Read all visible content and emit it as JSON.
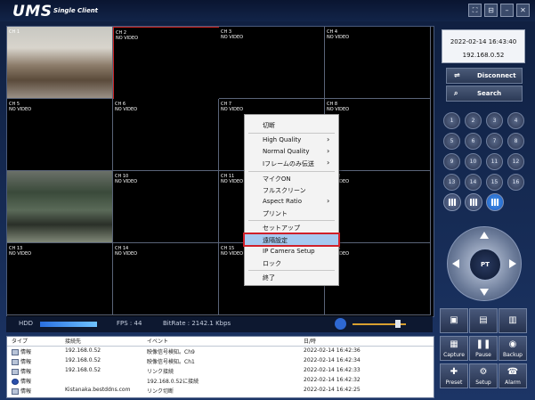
{
  "window": {
    "logo": "UMS",
    "subtitle": "Single Client",
    "controls": [
      "⛶",
      "⊟",
      "–",
      "✕"
    ]
  },
  "grid": {
    "cells": [
      {
        "label": "CH 1",
        "status": "",
        "video": true
      },
      {
        "label": "CH 2",
        "status": "NO VIDEO",
        "video": false
      },
      {
        "label": "CH 3",
        "status": "NO VIDEO",
        "video": false
      },
      {
        "label": "CH 4",
        "status": "NO VIDEO",
        "video": false
      },
      {
        "label": "CH 5",
        "status": "NO VIDEO",
        "video": false
      },
      {
        "label": "CH 6",
        "status": "NO VIDEO",
        "video": false
      },
      {
        "label": "CH 7",
        "status": "NO VIDEO",
        "video": false
      },
      {
        "label": "CH 8",
        "status": "NO VIDEO",
        "video": false
      },
      {
        "label": "",
        "status": "",
        "video": true
      },
      {
        "label": "CH 10",
        "status": "NO VIDEO",
        "video": false
      },
      {
        "label": "CH 11",
        "status": "NO VIDEO",
        "video": false
      },
      {
        "label": "CH 12",
        "status": "NO VIDEO",
        "video": false
      },
      {
        "label": "CH 13",
        "status": "NO VIDEO",
        "video": false
      },
      {
        "label": "CH 14",
        "status": "NO VIDEO",
        "video": false
      },
      {
        "label": "CH 15",
        "status": "NO VIDEO",
        "video": false
      },
      {
        "label": "CH 16",
        "status": "NO VIDEO",
        "video": false
      }
    ]
  },
  "context_menu": {
    "items": [
      "切断",
      "High Quality",
      "Normal Quality",
      "Iフレームのみ伝送",
      "マイクON",
      "フルスクリーン",
      "Aspect Ratio",
      "プリント",
      "セットアップ",
      "遠隔設定",
      "IP Camera Setup",
      "ロック",
      "終了"
    ],
    "highlighted": "遠隔設定"
  },
  "status": {
    "hdd_label": "HDD",
    "hdd_fill": 0.85,
    "fps": "FPS :  44",
    "bitrate": "BitRate : 2142.1 Kbps",
    "volume": 0.85
  },
  "event_log": {
    "headers": [
      "タイプ",
      "接続先",
      "イベント",
      "日/時"
    ],
    "rows": [
      {
        "type": "情報",
        "host": "192.168.0.52",
        "event": "映像信号検知。Ch9",
        "time": "2022-02-14 16:42:36",
        "icon": "monitor-icon"
      },
      {
        "type": "情報",
        "host": "192.168.0.52",
        "event": "映像信号検知。Ch1",
        "time": "2022-02-14 16:42:34",
        "icon": "monitor-icon"
      },
      {
        "type": "情報",
        "host": "192.168.0.52",
        "event": "リンク接続",
        "time": "2022-02-14 16:42:33",
        "icon": "monitor-icon"
      },
      {
        "type": "情報",
        "host": "",
        "event": "192.168.0.52に接続",
        "time": "2022-02-14 16:42:32",
        "icon": "info-icon"
      },
      {
        "type": "情報",
        "host": "Kistanaka.bestddns.com",
        "event": "リンク切断",
        "time": "2022-02-14 16:42:25",
        "icon": "monitor-icon"
      }
    ]
  },
  "side_panel": {
    "datetime": "2022-02-14 16:43:40",
    "ip": "192.168.0.52",
    "disconnect_label": "Disconnect",
    "search_label": "Search",
    "channels": [
      "1",
      "2",
      "3",
      "4",
      "5",
      "6",
      "7",
      "8",
      "9",
      "10",
      "11",
      "12",
      "13",
      "14",
      "15",
      "16"
    ],
    "ptz_label": "PT",
    "bottom_buttons": [
      {
        "label": "",
        "icon": "camera-a-icon",
        "glyph": "▣"
      },
      {
        "label": "",
        "icon": "camera-b-icon",
        "glyph": "▤"
      },
      {
        "label": "",
        "icon": "camera-c-icon",
        "glyph": "▥"
      },
      {
        "label": "Capture",
        "icon": "capture-icon",
        "glyph": "▦"
      },
      {
        "label": "Pause",
        "icon": "pause-icon",
        "glyph": "❚❚"
      },
      {
        "label": "Backup",
        "icon": "backup-icon",
        "glyph": "◉"
      },
      {
        "label": "Preset",
        "icon": "preset-icon",
        "glyph": "✚"
      },
      {
        "label": "Setup",
        "icon": "setup-icon",
        "glyph": "⚙"
      },
      {
        "label": "Alarm",
        "icon": "alarm-icon",
        "glyph": "☎"
      }
    ]
  }
}
